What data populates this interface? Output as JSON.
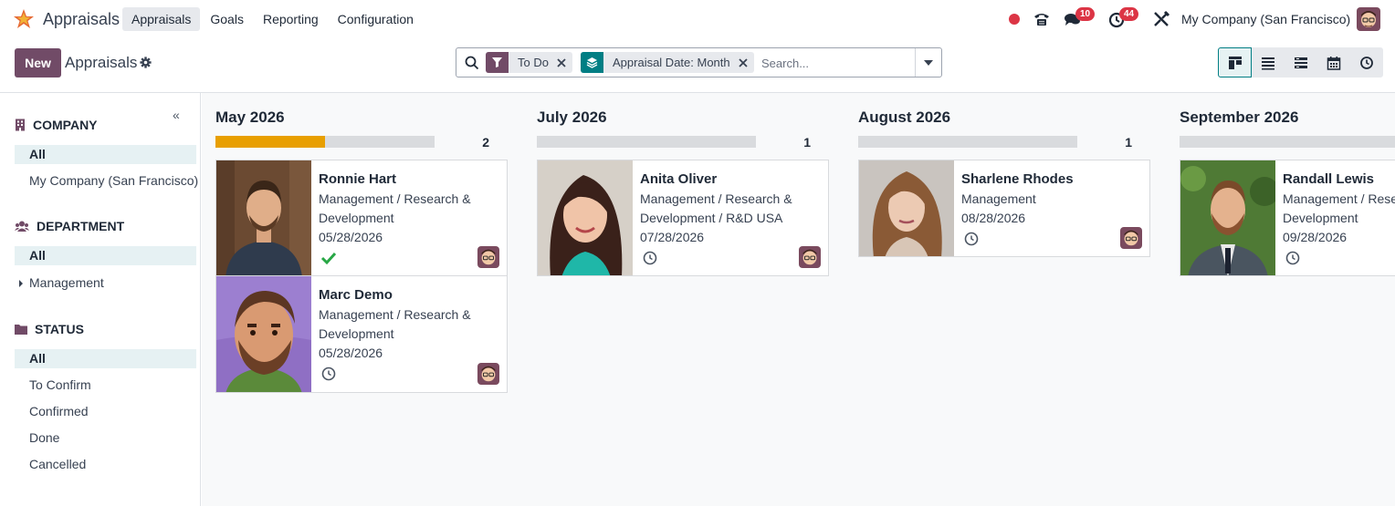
{
  "app": {
    "name": "Appraisals"
  },
  "menu": [
    "Appraisals",
    "Goals",
    "Reporting",
    "Configuration"
  ],
  "systray": {
    "messages_count": "10",
    "activities_count": "44",
    "company": "My Company (San Francisco)"
  },
  "control": {
    "new_label": "New",
    "title": "Appraisals",
    "facets": [
      {
        "label": "To Do",
        "kind": "filter",
        "color": "#714b67"
      },
      {
        "label": "Appraisal Date: Month",
        "kind": "groupby",
        "color": "#017e84"
      }
    ],
    "search_placeholder": "Search...",
    "views": [
      "kanban",
      "list",
      "activity-list",
      "calendar",
      "activity"
    ]
  },
  "sidebar": {
    "sections": [
      {
        "title": "COMPANY",
        "items": [
          "All",
          "My Company (San Francisco)"
        ]
      },
      {
        "title": "DEPARTMENT",
        "items": [
          "All",
          "Management"
        ]
      },
      {
        "title": "STATUS",
        "items": [
          "All",
          "To Confirm",
          "Confirmed",
          "Done",
          "Cancelled"
        ]
      }
    ]
  },
  "colors": {
    "brand": "#714b67",
    "accent": "#017e84",
    "progress": "#e89f00"
  },
  "columns": [
    {
      "title": "May 2026",
      "count": "2",
      "progress": 0.5,
      "cards": [
        {
          "name": "Ronnie Hart",
          "dept": "Management / Research & Development",
          "date": "05/28/2026",
          "status": "done"
        },
        {
          "name": "Marc Demo",
          "dept": "Management / Research & Development",
          "date": "05/28/2026",
          "status": "clock"
        }
      ]
    },
    {
      "title": "July 2026",
      "count": "1",
      "progress": 0,
      "cards": [
        {
          "name": "Anita Oliver",
          "dept": "Management / Research & Development / R&D USA",
          "date": "07/28/2026",
          "status": "clock"
        }
      ]
    },
    {
      "title": "August 2026",
      "count": "1",
      "progress": 0,
      "cards": [
        {
          "name": "Sharlene Rhodes",
          "dept": "Management",
          "date": "08/28/2026",
          "status": "clock"
        }
      ]
    },
    {
      "title": "September 2026",
      "count": "",
      "progress": 0,
      "cards": [
        {
          "name": "Randall Lewis",
          "dept": "Management / Research & Development",
          "date": "09/28/2026",
          "status": "clock"
        }
      ]
    }
  ]
}
